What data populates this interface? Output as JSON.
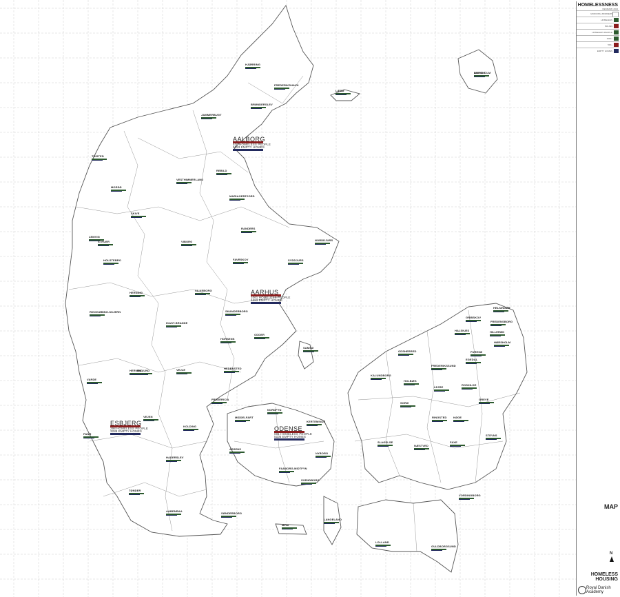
{
  "title_block": {
    "heading": "HOMELESSNESS",
    "subheading": "DENMARK 2024",
    "legend": [
      {
        "label": "MUNICIPAL BORDERS",
        "color": "#ffffff"
      },
      {
        "label": "HOMELESS",
        "color": "#2c5a2e"
      },
      {
        "label": "500-999",
        "color": "#8b1d1d"
      },
      {
        "label": "HOMELESS PEOPLE",
        "color": "#2c5a2e"
      },
      {
        "label": "1000+",
        "color": "#2c5a2e"
      },
      {
        "label": "500+",
        "color": "#8b1d1d"
      },
      {
        "label": "EMPTY HOMES",
        "color": "#222a5e"
      }
    ],
    "drawing_label": "MAP",
    "project": "HOMELESS HOUSING",
    "institution_line1": "Royal Danish",
    "institution_line2": "Academy"
  },
  "north_label": "N",
  "cities": [
    {
      "name": "HJØRRING"
    },
    {
      "name": "FREDERIKSHAVN"
    },
    {
      "name": "BRØNDERSLEV"
    },
    {
      "name": "LÆSØ"
    },
    {
      "name": "ANHOLT"
    },
    {
      "name": "JAMMERBUGT"
    },
    {
      "name": "AALBORG",
      "count": "530 HOMELESS PEOPLE",
      "empty": "5653 EMPTY HOMES"
    },
    {
      "name": "THISTED"
    },
    {
      "name": "REBILD"
    },
    {
      "name": "VESTHIMMERLAND"
    },
    {
      "name": "MORSØ"
    },
    {
      "name": "MARIAGERFJORD"
    },
    {
      "name": "SKIVE"
    },
    {
      "name": "RANDERS"
    },
    {
      "name": "LEMVIG"
    },
    {
      "name": "STRUER"
    },
    {
      "name": "VIBORG"
    },
    {
      "name": "NORDDJURS"
    },
    {
      "name": "HOLSTEBRO"
    },
    {
      "name": "FAVRSKOV"
    },
    {
      "name": "SYDDJURS"
    },
    {
      "name": "HERNING"
    },
    {
      "name": "SILKEBORG"
    },
    {
      "name": "AARHUS",
      "count": "1061 HOMELESS PEOPLE",
      "empty": "6683 EMPTY HOMES"
    },
    {
      "name": "RINGKØBING-SKJERN"
    },
    {
      "name": "IKAST-BRANDE"
    },
    {
      "name": "SKANDERBORG"
    },
    {
      "name": "ODDER"
    },
    {
      "name": "HORSENS"
    },
    {
      "name": "SAMSØ"
    },
    {
      "name": "HELSINGØR"
    },
    {
      "name": "GRIBSKOV"
    },
    {
      "name": "HALSNÆS"
    },
    {
      "name": "HILLERØD"
    },
    {
      "name": "FREDENSBORG"
    },
    {
      "name": "HØRSHOLM"
    },
    {
      "name": "ODSHERRED"
    },
    {
      "name": "FURESØ"
    },
    {
      "name": "EGEDAL"
    },
    {
      "name": "FREDERIKSSUND"
    },
    {
      "name": "HERNING"
    },
    {
      "name": "BILLUND"
    },
    {
      "name": "VEJLE"
    },
    {
      "name": "HEDENSTED"
    },
    {
      "name": "KALUNDBORG"
    },
    {
      "name": "HOLBÆK"
    },
    {
      "name": "ROSKILDE"
    },
    {
      "name": "VARDE"
    },
    {
      "name": "FREDERICIA"
    },
    {
      "name": "SORØ"
    },
    {
      "name": "LEJRE"
    },
    {
      "name": "GREVE"
    },
    {
      "name": "KOLDING"
    },
    {
      "name": "MIDDELFART"
    },
    {
      "name": "NORDFYN"
    },
    {
      "name": "ESBJERG",
      "count": "298 HOMELESS PEOPLE",
      "empty": "3289 EMPTY HOMES"
    },
    {
      "name": "VEJEN"
    },
    {
      "name": "ODENSE",
      "count": "691 HOMELESS PEOPLE",
      "empty": "5105 EMPTY HOMES"
    },
    {
      "name": "KERTEMINDE"
    },
    {
      "name": "FANØ"
    },
    {
      "name": "RINGSTED"
    },
    {
      "name": "KØGE"
    },
    {
      "name": "STEVNS"
    },
    {
      "name": "SLAGELSE"
    },
    {
      "name": "NÆSTVED"
    },
    {
      "name": "FAXE"
    },
    {
      "name": "ASSENS"
    },
    {
      "name": "NYBORG"
    },
    {
      "name": "HADERSLEV"
    },
    {
      "name": "FAABORG-MIDTFYN"
    },
    {
      "name": "SVENDBORG"
    },
    {
      "name": "VORDINGBORG"
    },
    {
      "name": "TØNDER"
    },
    {
      "name": "AABENRAA"
    },
    {
      "name": "SØNDERBORG"
    },
    {
      "name": "ÆRØ"
    },
    {
      "name": "LANGELAND"
    },
    {
      "name": "LOLLAND"
    },
    {
      "name": "GULDBORGSUND"
    },
    {
      "name": "BORNHOLM"
    }
  ]
}
